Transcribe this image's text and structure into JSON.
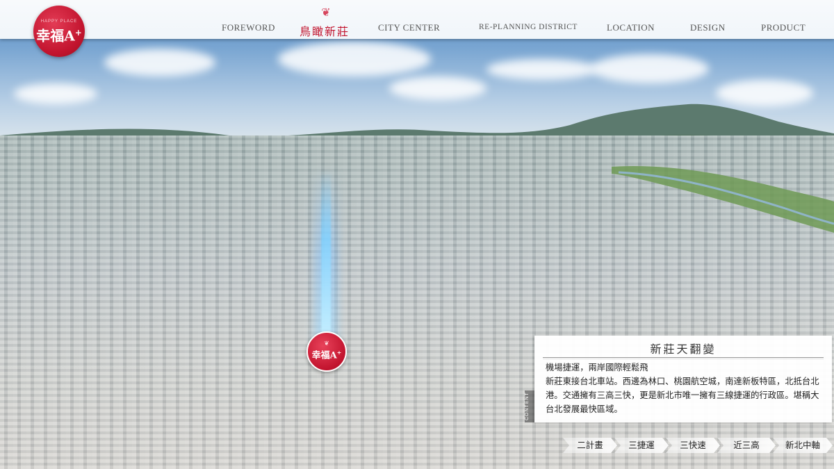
{
  "header": {
    "logo": {
      "small_text": "HAPPY PLACE",
      "text": "幸福A",
      "sup": "+"
    },
    "nav": [
      {
        "label": "FOREWORD"
      },
      {
        "label": "鳥瞰新莊",
        "active": true
      },
      {
        "label": "CITY CENTER"
      },
      {
        "label": "RE-PLANNING DISTRICT"
      },
      {
        "label": "LOCATION"
      },
      {
        "label": "DESIGN"
      },
      {
        "label": "PRODUCT"
      }
    ]
  },
  "map_marker": {
    "text": "幸福A",
    "sup": "+"
  },
  "content_panel": {
    "tab_label": "CONTENT",
    "title": "新莊天翻變",
    "lead": "機場捷運，兩岸國際輕鬆飛",
    "body": "新莊東接台北車站。西邊為林口、桃園航空城，南達新板特區，北抵台北港。交通擁有三高三快，更是新北市唯一擁有三線捷運的行政區。堪稱大台北發展最快區域。"
  },
  "subtabs": [
    "二計畫",
    "三捷運",
    "三快速",
    "近三高",
    "新北中軸"
  ],
  "colors": {
    "brand_red": "#c2142e",
    "nav_text": "#555555",
    "panel_bg": "#ffffff"
  }
}
